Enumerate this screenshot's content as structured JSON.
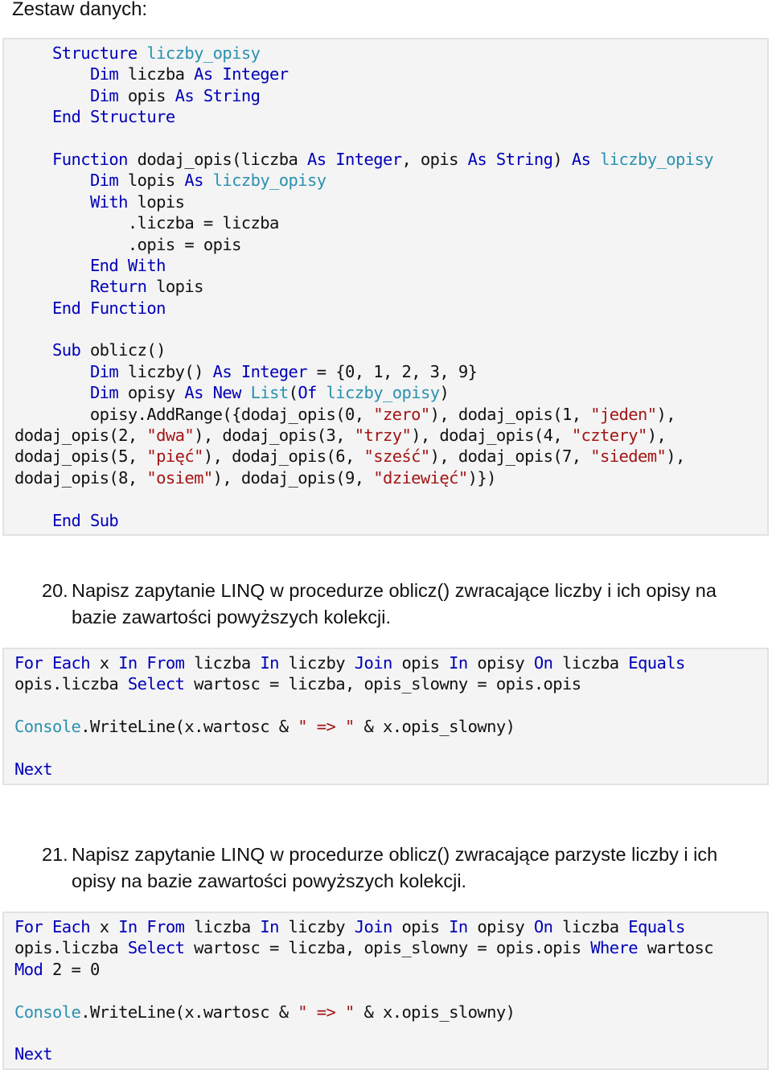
{
  "heading": "Zestaw danych:",
  "dataset_code": {
    "lines": [
      [
        {
          "t": "    "
        },
        {
          "k": "kw",
          "t": "Structure"
        },
        {
          "t": " "
        },
        {
          "k": "ty",
          "t": "liczby_opisy"
        }
      ],
      [
        {
          "t": "        "
        },
        {
          "k": "kw",
          "t": "Dim"
        },
        {
          "t": " liczba "
        },
        {
          "k": "kw",
          "t": "As"
        },
        {
          "t": " "
        },
        {
          "k": "kw",
          "t": "Integer"
        }
      ],
      [
        {
          "t": "        "
        },
        {
          "k": "kw",
          "t": "Dim"
        },
        {
          "t": " opis "
        },
        {
          "k": "kw",
          "t": "As"
        },
        {
          "t": " "
        },
        {
          "k": "kw",
          "t": "String"
        }
      ],
      [
        {
          "t": "    "
        },
        {
          "k": "kw",
          "t": "End"
        },
        {
          "t": " "
        },
        {
          "k": "kw",
          "t": "Structure"
        }
      ],
      [
        {
          "t": ""
        }
      ],
      [
        {
          "t": "    "
        },
        {
          "k": "kw",
          "t": "Function"
        },
        {
          "t": " dodaj_opis(liczba "
        },
        {
          "k": "kw",
          "t": "As"
        },
        {
          "t": " "
        },
        {
          "k": "kw",
          "t": "Integer"
        },
        {
          "t": ", opis "
        },
        {
          "k": "kw",
          "t": "As"
        },
        {
          "t": " "
        },
        {
          "k": "kw",
          "t": "String"
        },
        {
          "t": ") "
        },
        {
          "k": "kw",
          "t": "As"
        },
        {
          "t": " "
        },
        {
          "k": "ty",
          "t": "liczby_opisy"
        }
      ],
      [
        {
          "t": "        "
        },
        {
          "k": "kw",
          "t": "Dim"
        },
        {
          "t": " lopis "
        },
        {
          "k": "kw",
          "t": "As"
        },
        {
          "t": " "
        },
        {
          "k": "ty",
          "t": "liczby_opisy"
        }
      ],
      [
        {
          "t": "        "
        },
        {
          "k": "kw",
          "t": "With"
        },
        {
          "t": " lopis"
        }
      ],
      [
        {
          "t": "            .liczba = liczba"
        }
      ],
      [
        {
          "t": "            .opis = opis"
        }
      ],
      [
        {
          "t": "        "
        },
        {
          "k": "kw",
          "t": "End"
        },
        {
          "t": " "
        },
        {
          "k": "kw",
          "t": "With"
        }
      ],
      [
        {
          "t": "        "
        },
        {
          "k": "kw",
          "t": "Return"
        },
        {
          "t": " lopis"
        }
      ],
      [
        {
          "t": "    "
        },
        {
          "k": "kw",
          "t": "End"
        },
        {
          "t": " "
        },
        {
          "k": "kw",
          "t": "Function"
        }
      ],
      [
        {
          "t": ""
        }
      ],
      [
        {
          "t": "    "
        },
        {
          "k": "kw",
          "t": "Sub"
        },
        {
          "t": " oblicz()"
        }
      ],
      [
        {
          "t": "        "
        },
        {
          "k": "kw",
          "t": "Dim"
        },
        {
          "t": " liczby() "
        },
        {
          "k": "kw",
          "t": "As"
        },
        {
          "t": " "
        },
        {
          "k": "kw",
          "t": "Integer"
        },
        {
          "t": " = {0, 1, 2, 3, 9}"
        }
      ],
      [
        {
          "t": "        "
        },
        {
          "k": "kw",
          "t": "Dim"
        },
        {
          "t": " opisy "
        },
        {
          "k": "kw",
          "t": "As"
        },
        {
          "t": " "
        },
        {
          "k": "kw",
          "t": "New"
        },
        {
          "t": " "
        },
        {
          "k": "ty",
          "t": "List"
        },
        {
          "t": "("
        },
        {
          "k": "kw",
          "t": "Of"
        },
        {
          "t": " "
        },
        {
          "k": "ty",
          "t": "liczby_opisy"
        },
        {
          "t": ")"
        }
      ],
      [
        {
          "t": "        opisy.AddRange({dodaj_opis(0, "
        },
        {
          "k": "st",
          "t": "\"zero\""
        },
        {
          "t": "), dodaj_opis(1, "
        },
        {
          "k": "st",
          "t": "\"jeden\""
        },
        {
          "t": "),"
        }
      ],
      [
        {
          "t": "dodaj_opis(2, "
        },
        {
          "k": "st",
          "t": "\"dwa\""
        },
        {
          "t": "), dodaj_opis(3, "
        },
        {
          "k": "st",
          "t": "\"trzy\""
        },
        {
          "t": "), dodaj_opis(4, "
        },
        {
          "k": "st",
          "t": "\"cztery\""
        },
        {
          "t": "),"
        }
      ],
      [
        {
          "t": "dodaj_opis(5, "
        },
        {
          "k": "st",
          "t": "\"pięć\""
        },
        {
          "t": "), dodaj_opis(6, "
        },
        {
          "k": "st",
          "t": "\"sześć\""
        },
        {
          "t": "), dodaj_opis(7, "
        },
        {
          "k": "st",
          "t": "\"siedem\""
        },
        {
          "t": "),"
        }
      ],
      [
        {
          "t": "dodaj_opis(8, "
        },
        {
          "k": "st",
          "t": "\"osiem\""
        },
        {
          "t": "), dodaj_opis(9, "
        },
        {
          "k": "st",
          "t": "\"dziewięć\""
        },
        {
          "t": ")})"
        }
      ],
      [
        {
          "t": ""
        }
      ],
      [
        {
          "t": "    "
        },
        {
          "k": "kw",
          "t": "End"
        },
        {
          "t": " "
        },
        {
          "k": "kw",
          "t": "Sub"
        }
      ]
    ]
  },
  "tasks": [
    {
      "number": "20.",
      "text": "Napisz zapytanie LINQ w procedurze oblicz() zwracające liczby i ich opisy na bazie zawartości powyższych kolekcji.",
      "code": {
        "lines": [
          [
            {
              "k": "kw",
              "t": "For"
            },
            {
              "t": " "
            },
            {
              "k": "kw",
              "t": "Each"
            },
            {
              "t": " x "
            },
            {
              "k": "kw",
              "t": "In"
            },
            {
              "t": " "
            },
            {
              "k": "kw",
              "t": "From"
            },
            {
              "t": " liczba "
            },
            {
              "k": "kw",
              "t": "In"
            },
            {
              "t": " liczby "
            },
            {
              "k": "kw",
              "t": "Join"
            },
            {
              "t": " opis "
            },
            {
              "k": "kw",
              "t": "In"
            },
            {
              "t": " opisy "
            },
            {
              "k": "kw",
              "t": "On"
            },
            {
              "t": " liczba "
            },
            {
              "k": "kw",
              "t": "Equals"
            }
          ],
          [
            {
              "t": "opis.liczba "
            },
            {
              "k": "kw",
              "t": "Select"
            },
            {
              "t": " wartosc = liczba, opis_slowny = opis.opis"
            }
          ],
          [
            {
              "t": ""
            }
          ],
          [
            {
              "k": "ty",
              "t": "Console"
            },
            {
              "t": ".WriteLine(x.wartosc & "
            },
            {
              "k": "st",
              "t": "\" => \""
            },
            {
              "t": " & x.opis_slowny)"
            }
          ],
          [
            {
              "t": ""
            }
          ],
          [
            {
              "k": "kw",
              "t": "Next"
            }
          ]
        ]
      }
    },
    {
      "number": "21.",
      "text": "Napisz zapytanie LINQ w procedurze oblicz() zwracające parzyste liczby i ich opisy na bazie zawartości powyższych kolekcji.",
      "code": {
        "lines": [
          [
            {
              "k": "kw",
              "t": "For"
            },
            {
              "t": " "
            },
            {
              "k": "kw",
              "t": "Each"
            },
            {
              "t": " x "
            },
            {
              "k": "kw",
              "t": "In"
            },
            {
              "t": " "
            },
            {
              "k": "kw",
              "t": "From"
            },
            {
              "t": " liczba "
            },
            {
              "k": "kw",
              "t": "In"
            },
            {
              "t": " liczby "
            },
            {
              "k": "kw",
              "t": "Join"
            },
            {
              "t": " opis "
            },
            {
              "k": "kw",
              "t": "In"
            },
            {
              "t": " opisy "
            },
            {
              "k": "kw",
              "t": "On"
            },
            {
              "t": " liczba "
            },
            {
              "k": "kw",
              "t": "Equals"
            }
          ],
          [
            {
              "t": "opis.liczba "
            },
            {
              "k": "kw",
              "t": "Select"
            },
            {
              "t": " wartosc = liczba, opis_slowny = opis.opis "
            },
            {
              "k": "kw",
              "t": "Where"
            },
            {
              "t": " wartosc"
            }
          ],
          [
            {
              "k": "kw",
              "t": "Mod"
            },
            {
              "t": " 2 = 0"
            }
          ],
          [
            {
              "t": ""
            }
          ],
          [
            {
              "k": "ty",
              "t": "Console"
            },
            {
              "t": ".WriteLine(x.wartosc & "
            },
            {
              "k": "st",
              "t": "\" => \""
            },
            {
              "t": " & x.opis_slowny)"
            }
          ],
          [
            {
              "t": ""
            }
          ],
          [
            {
              "k": "kw",
              "t": "Next"
            }
          ]
        ]
      }
    }
  ]
}
